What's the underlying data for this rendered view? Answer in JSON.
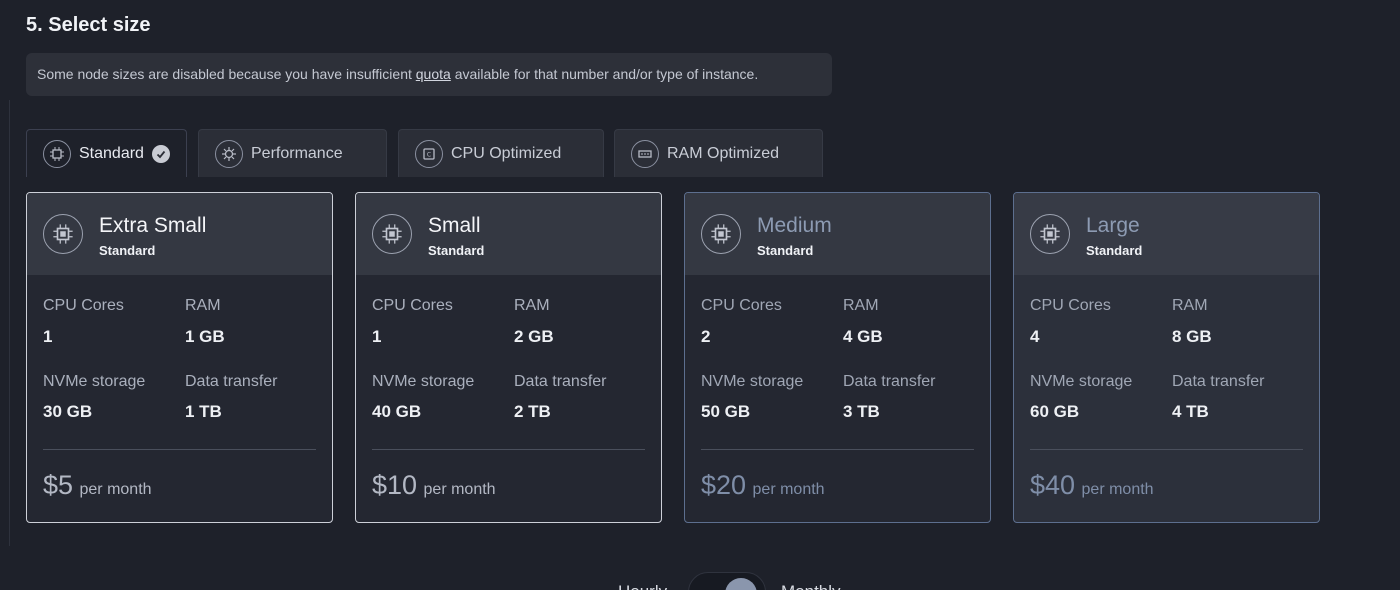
{
  "section": {
    "title": "5. Select size",
    "notice_before": "Some node sizes are disabled because you have insufficient ",
    "notice_link": "quota",
    "notice_after": " available for that number and/or type of instance."
  },
  "tabs": [
    {
      "label": "Standard",
      "icon": "cpu-chip-icon",
      "active": true
    },
    {
      "label": "Performance",
      "icon": "cpu-gear-icon",
      "active": false
    },
    {
      "label": "CPU Optimized",
      "icon": "cpu-fast-icon",
      "active": false
    },
    {
      "label": "RAM Optimized",
      "icon": "memory-icon",
      "active": false
    }
  ],
  "spec_labels": {
    "cpu": "CPU Cores",
    "ram": "RAM",
    "storage": "NVMe storage",
    "transfer": "Data transfer",
    "per": "per month"
  },
  "cards": [
    {
      "name": "Extra Small",
      "type": "Standard",
      "cpu": "1",
      "ram": "1 GB",
      "storage": "30 GB",
      "transfer": "1 TB",
      "price": "$5",
      "disabled": false
    },
    {
      "name": "Small",
      "type": "Standard",
      "cpu": "1",
      "ram": "2 GB",
      "storage": "40 GB",
      "transfer": "2 TB",
      "price": "$10",
      "disabled": false
    },
    {
      "name": "Medium",
      "type": "Standard",
      "cpu": "2",
      "ram": "4 GB",
      "storage": "50 GB",
      "transfer": "3 TB",
      "price": "$20",
      "disabled": true
    },
    {
      "name": "Large",
      "type": "Standard",
      "cpu": "4",
      "ram": "8 GB",
      "storage": "60 GB",
      "transfer": "4 TB",
      "price": "$40",
      "disabled": true
    }
  ],
  "billing": {
    "left_label": "Hourly",
    "right_label": "Monthly"
  }
}
